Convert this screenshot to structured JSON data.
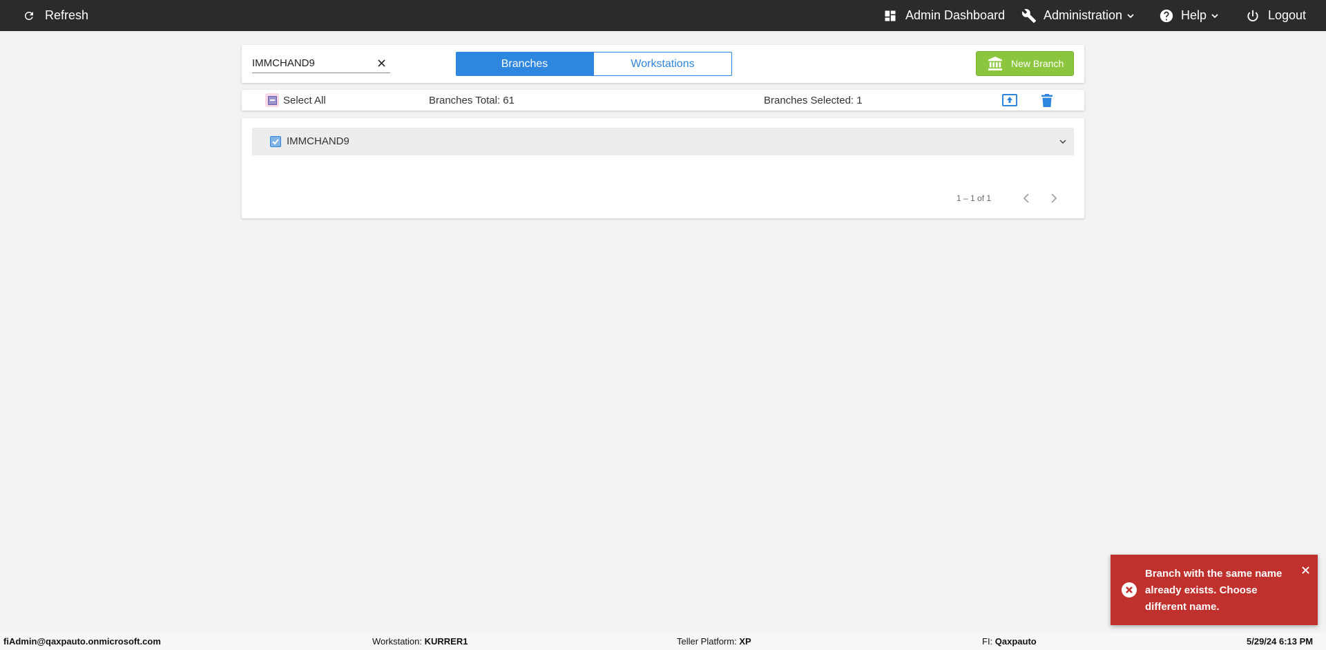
{
  "topbar": {
    "refresh_label": "Refresh",
    "dashboard_label": "Admin Dashboard",
    "administration_label": "Administration",
    "help_label": "Help",
    "logout_label": "Logout"
  },
  "search": {
    "value": "IMMCHAND9",
    "placeholder": ""
  },
  "tabs": {
    "branches_label": "Branches",
    "workstations_label": "Workstations",
    "active": "Branches"
  },
  "new_branch_label": "New Branch",
  "toolbar": {
    "select_all_label": "Select All",
    "branches_total": "Branches Total: 61",
    "branches_selected": "Branches Selected: 1"
  },
  "list": {
    "items": [
      {
        "label": "IMMCHAND9",
        "checked": true
      }
    ],
    "pager_text": "1 – 1 of 1"
  },
  "toast": {
    "message": "Branch with the same name already exists. Choose different name.",
    "color": "#c0302d"
  },
  "footer": {
    "user": "fiAdmin@qaxpauto.onmicrosoft.com",
    "workstation_label": "Workstation: ",
    "workstation_value": "KURRER1",
    "teller_platform_label": "Teller Platform: ",
    "teller_platform_value": "XP",
    "fi_label": "FI: ",
    "fi_value": "Qaxpauto",
    "datetime": "5/29/24 6:13 PM"
  },
  "colors": {
    "accent": "#2e86de",
    "success": "#8cc63e",
    "topbar": "#2b2b2b"
  }
}
